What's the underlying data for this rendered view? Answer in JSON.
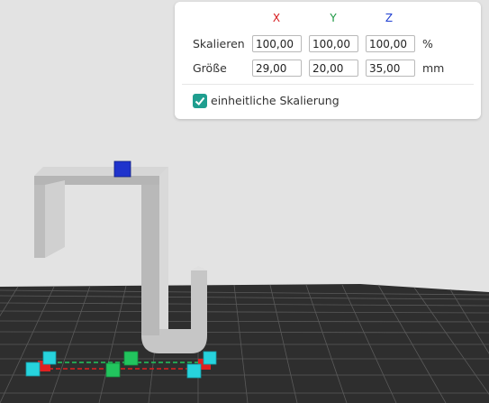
{
  "scale_panel": {
    "axes": {
      "x": "X",
      "y": "Y",
      "z": "Z"
    },
    "axis_colors": {
      "x": "#d7191c",
      "y": "#1a9641",
      "z": "#1f3fd1"
    },
    "rows": {
      "scale": {
        "label": "Skalieren",
        "x": "100,00",
        "y": "100,00",
        "z": "100,00",
        "unit": "%"
      },
      "size": {
        "label": "Größe",
        "x": "29,00",
        "y": "20,00",
        "z": "35,00",
        "unit": "mm"
      }
    },
    "uniform": {
      "label": "einheitliche Skalierung",
      "checked": true
    }
  },
  "viewport": {
    "background": "#e3e3e3",
    "bed_color": "#2e2e2e",
    "model_color": "#bfbfbf",
    "handle_colors": {
      "x": "#e02020",
      "y": "#22c55e",
      "z": "#1f33cc",
      "corner": "#27d3dd"
    }
  }
}
